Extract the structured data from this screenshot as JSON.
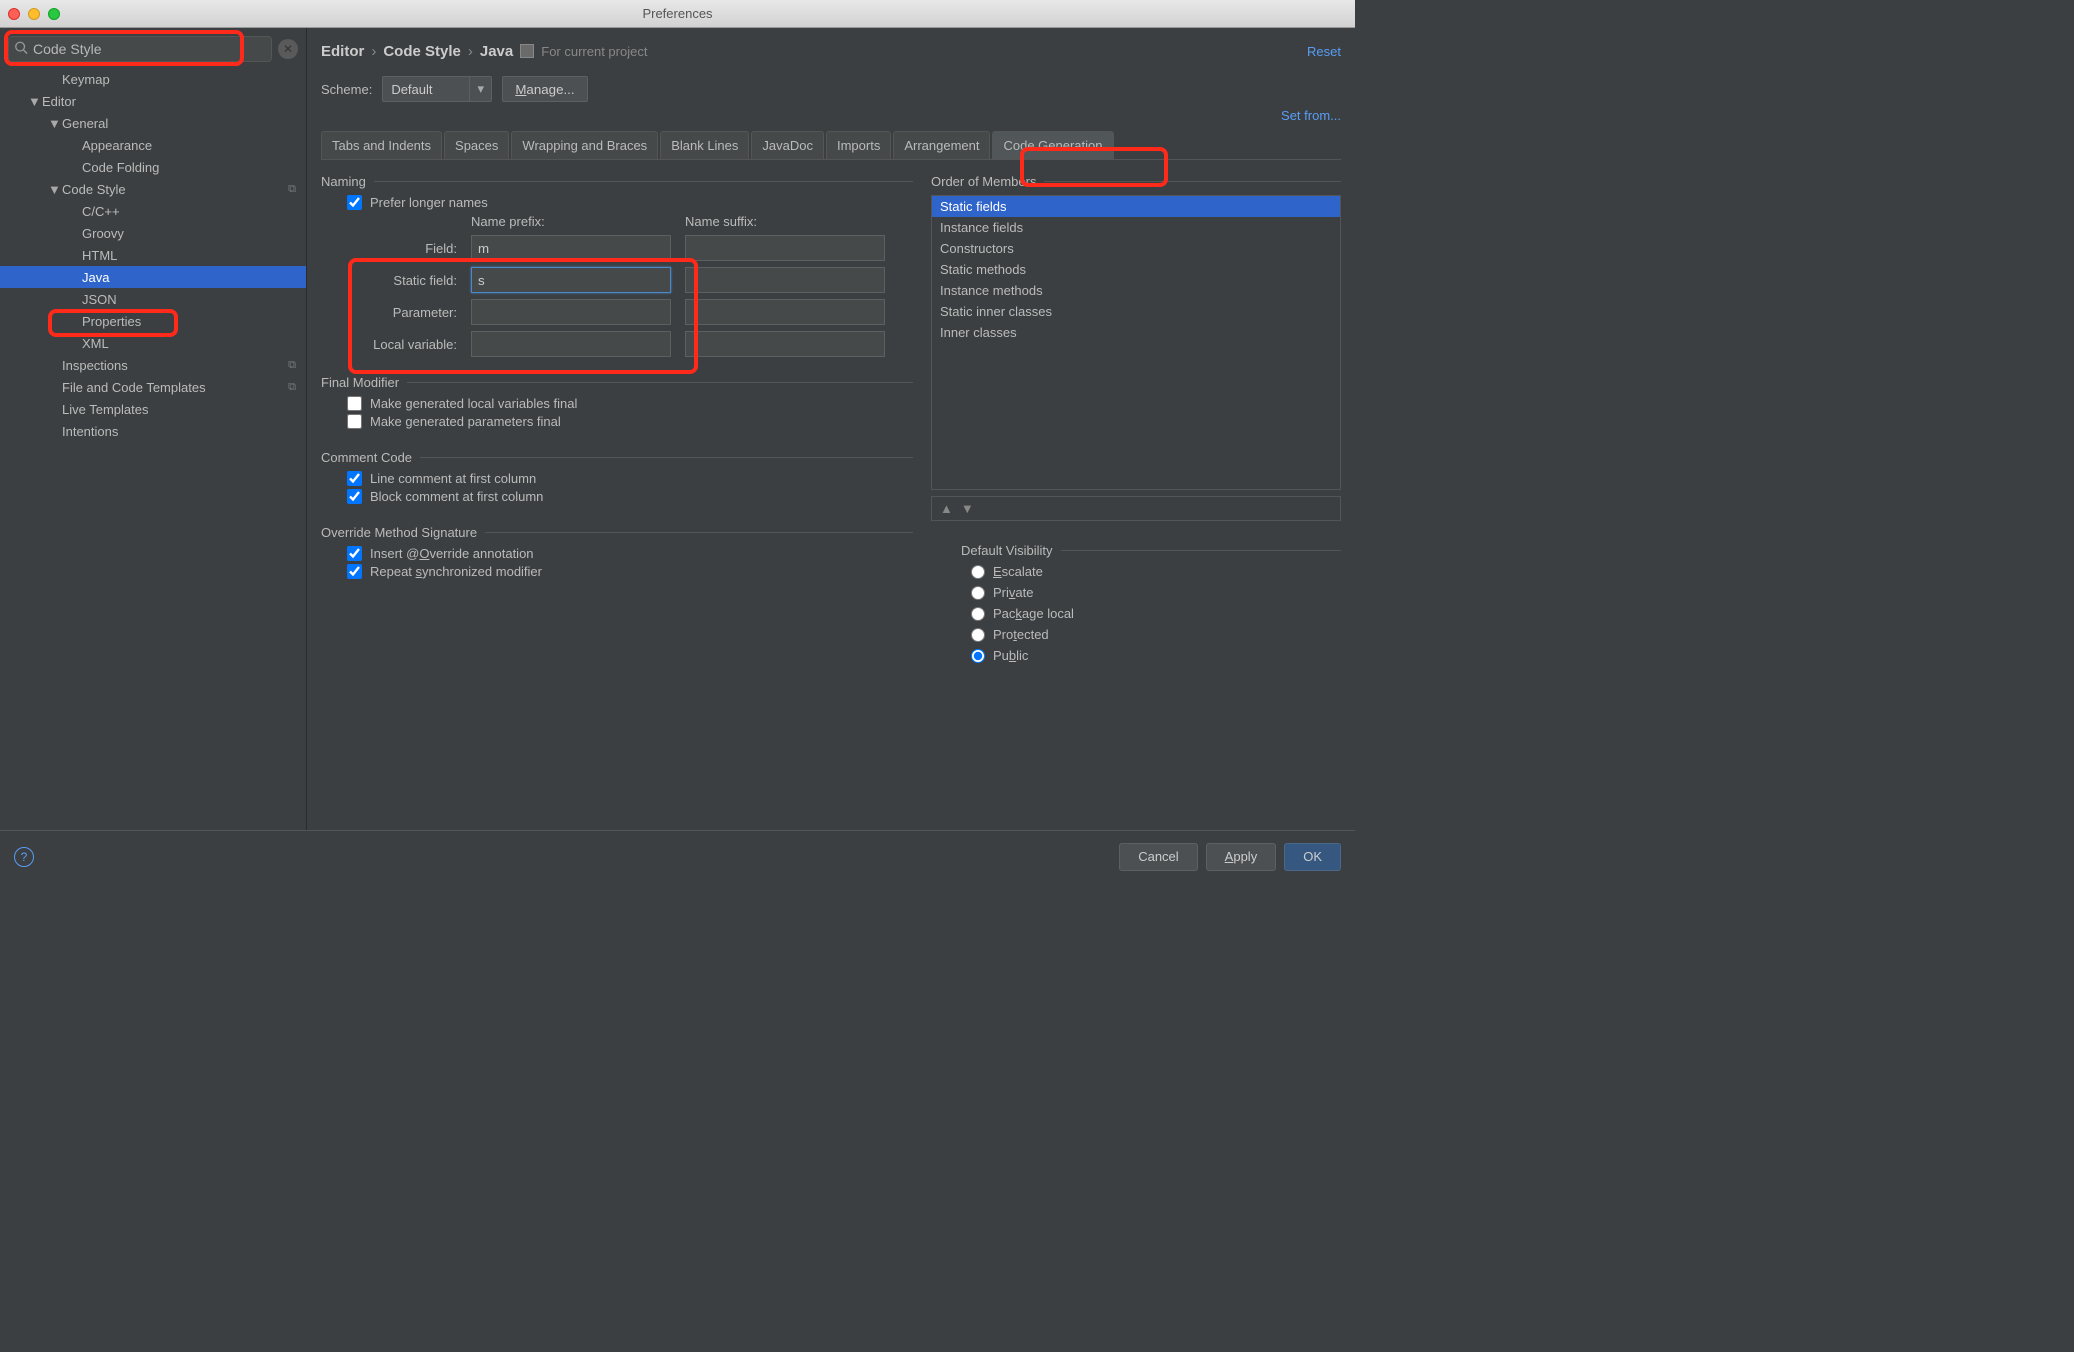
{
  "window": {
    "title": "Preferences"
  },
  "search": {
    "value": "Code Style"
  },
  "sidebar": {
    "items": [
      {
        "label": "Keymap",
        "indent": 1
      },
      {
        "label": "Editor",
        "indent": 0,
        "expanded": true
      },
      {
        "label": "General",
        "indent": 1,
        "expanded": true
      },
      {
        "label": "Appearance",
        "indent": 2
      },
      {
        "label": "Code Folding",
        "indent": 2
      },
      {
        "label": "Code Style",
        "indent": 1,
        "expanded": true,
        "icon": true
      },
      {
        "label": "C/C++",
        "indent": 2
      },
      {
        "label": "Groovy",
        "indent": 2
      },
      {
        "label": "HTML",
        "indent": 2
      },
      {
        "label": "Java",
        "indent": 2,
        "selected": true
      },
      {
        "label": "JSON",
        "indent": 2
      },
      {
        "label": "Properties",
        "indent": 2
      },
      {
        "label": "XML",
        "indent": 2
      },
      {
        "label": "Inspections",
        "indent": 1,
        "icon": true
      },
      {
        "label": "File and Code Templates",
        "indent": 1,
        "icon": true
      },
      {
        "label": "Live Templates",
        "indent": 1
      },
      {
        "label": "Intentions",
        "indent": 1
      }
    ]
  },
  "breadcrumb": {
    "a": "Editor",
    "b": "Code Style",
    "c": "Java",
    "project": "For current project",
    "reset": "Reset"
  },
  "scheme": {
    "label": "Scheme:",
    "value": "Default",
    "manage": "Manage...",
    "setfrom": "Set from..."
  },
  "tabs": [
    "Tabs and Indents",
    "Spaces",
    "Wrapping and Braces",
    "Blank Lines",
    "JavaDoc",
    "Imports",
    "Arrangement",
    "Code Generation"
  ],
  "activeTab": 7,
  "naming": {
    "title": "Naming",
    "prefer": "Prefer longer names",
    "prefix_head": "Name prefix:",
    "suffix_head": "Name suffix:",
    "rows": {
      "field": {
        "label": "Field:",
        "prefix": "m",
        "suffix": ""
      },
      "static": {
        "label": "Static field:",
        "prefix": "s",
        "suffix": ""
      },
      "param": {
        "label": "Parameter:",
        "prefix": "",
        "suffix": ""
      },
      "local": {
        "label": "Local variable:",
        "prefix": "",
        "suffix": ""
      }
    }
  },
  "finalmod": {
    "title": "Final Modifier",
    "a": "Make generated local variables final",
    "b": "Make generated parameters final"
  },
  "comment": {
    "title": "Comment Code",
    "a": "Line comment at first column",
    "b": "Block comment at first column"
  },
  "override": {
    "title": "Override Method Signature",
    "a_pre": "Insert @",
    "a_key": "O",
    "a_post": "verride annotation",
    "b_pre": "Repeat ",
    "b_key": "s",
    "b_post": "ynchronized modifier"
  },
  "order": {
    "title": "Order of Members",
    "items": [
      "Static fields",
      "Instance fields",
      "Constructors",
      "Static methods",
      "Instance methods",
      "Static inner classes",
      "Inner classes"
    ]
  },
  "visibility": {
    "title": "Default Visibility",
    "items": [
      {
        "pre": "",
        "key": "E",
        "post": "scalate"
      },
      {
        "pre": "Pri",
        "key": "v",
        "post": "ate"
      },
      {
        "pre": "Pac",
        "key": "k",
        "post": "age local"
      },
      {
        "pre": "Pro",
        "key": "t",
        "post": "ected"
      },
      {
        "pre": "Pu",
        "key": "b",
        "post": "lic"
      }
    ],
    "selected": 4
  },
  "footer": {
    "cancel": "Cancel",
    "apply": "Apply",
    "ok": "OK"
  }
}
